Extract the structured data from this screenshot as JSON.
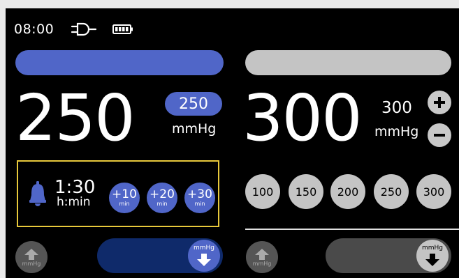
{
  "status": {
    "time": "08:00",
    "icons": [
      "plug-icon",
      "battery-icon"
    ]
  },
  "colors": {
    "accent": "#5066c8",
    "inactive": "#c4c4c4",
    "highlight_border": "#e8c93b",
    "slider_left": "#0f2a6a",
    "slider_right": "#4a4a4a"
  },
  "left_panel": {
    "pressure_value": "250",
    "set_value": "250",
    "unit": "mmHg",
    "timer": {
      "value": "1:30",
      "unit": "h:min",
      "add_buttons": [
        {
          "value": "+10",
          "unit": "min"
        },
        {
          "value": "+20",
          "unit": "min"
        },
        {
          "value": "+30",
          "unit": "min"
        }
      ]
    },
    "inflate_label": "mmHg",
    "deflate_label": "mmHg"
  },
  "right_panel": {
    "pressure_value": "300",
    "set_value": "300",
    "unit": "mmHg",
    "presets": [
      "100",
      "150",
      "200",
      "250",
      "300"
    ],
    "inflate_label": "mmHg",
    "deflate_label": "mmHg"
  }
}
